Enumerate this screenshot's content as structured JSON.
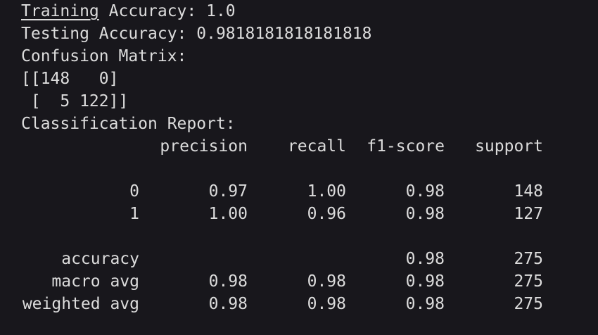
{
  "terminal": {
    "training_label": "Training",
    "training_rest": " Accuracy: 1.0",
    "testing": "Testing Accuracy: 0.9818181818181818",
    "confusion_title": "Confusion Matrix:",
    "matrix_row_1": "[[148   0]",
    "matrix_row_2": " [  5 122]]",
    "report_title": "Classification Report:",
    "report": {
      "headers": {
        "precision": "precision",
        "recall": "recall",
        "f1": "f1-score",
        "support": "support"
      },
      "rows": [
        {
          "label": "0",
          "precision": "0.97",
          "recall": "1.00",
          "f1": "0.98",
          "support": "148"
        },
        {
          "label": "1",
          "precision": "1.00",
          "recall": "0.96",
          "f1": "0.98",
          "support": "127"
        },
        {
          "label": "accuracy",
          "precision": "",
          "recall": "",
          "f1": "0.98",
          "support": "275"
        },
        {
          "label": "macro avg",
          "precision": "0.98",
          "recall": "0.98",
          "f1": "0.98",
          "support": "275"
        },
        {
          "label": "weighted avg",
          "precision": "0.98",
          "recall": "0.98",
          "f1": "0.98",
          "support": "275"
        }
      ]
    }
  }
}
